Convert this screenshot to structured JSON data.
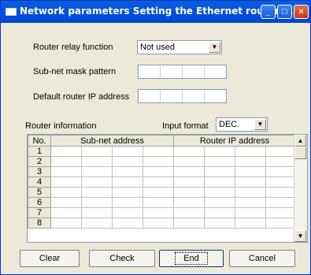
{
  "window": {
    "title": "Network parameters  Setting the Ethernet router ...",
    "minimize": "_",
    "maximize": "□",
    "close": "×"
  },
  "form": {
    "router_relay_label": "Router relay function",
    "router_relay_value": "Not used",
    "subnet_mask_label": "Sub-net mask pattern",
    "default_router_label": "Default router IP address"
  },
  "router_info": {
    "label": "Router information",
    "input_format_label": "Input format",
    "input_format_value": "DEC."
  },
  "table": {
    "col_no": "No.",
    "col_subnet": "Sub-net address",
    "col_router_ip": "Router IP address",
    "rows": [
      "1",
      "2",
      "3",
      "4",
      "5",
      "6",
      "7",
      "8"
    ]
  },
  "buttons": {
    "clear": "Clear",
    "check": "Check",
    "end": "End",
    "cancel": "Cancel"
  }
}
